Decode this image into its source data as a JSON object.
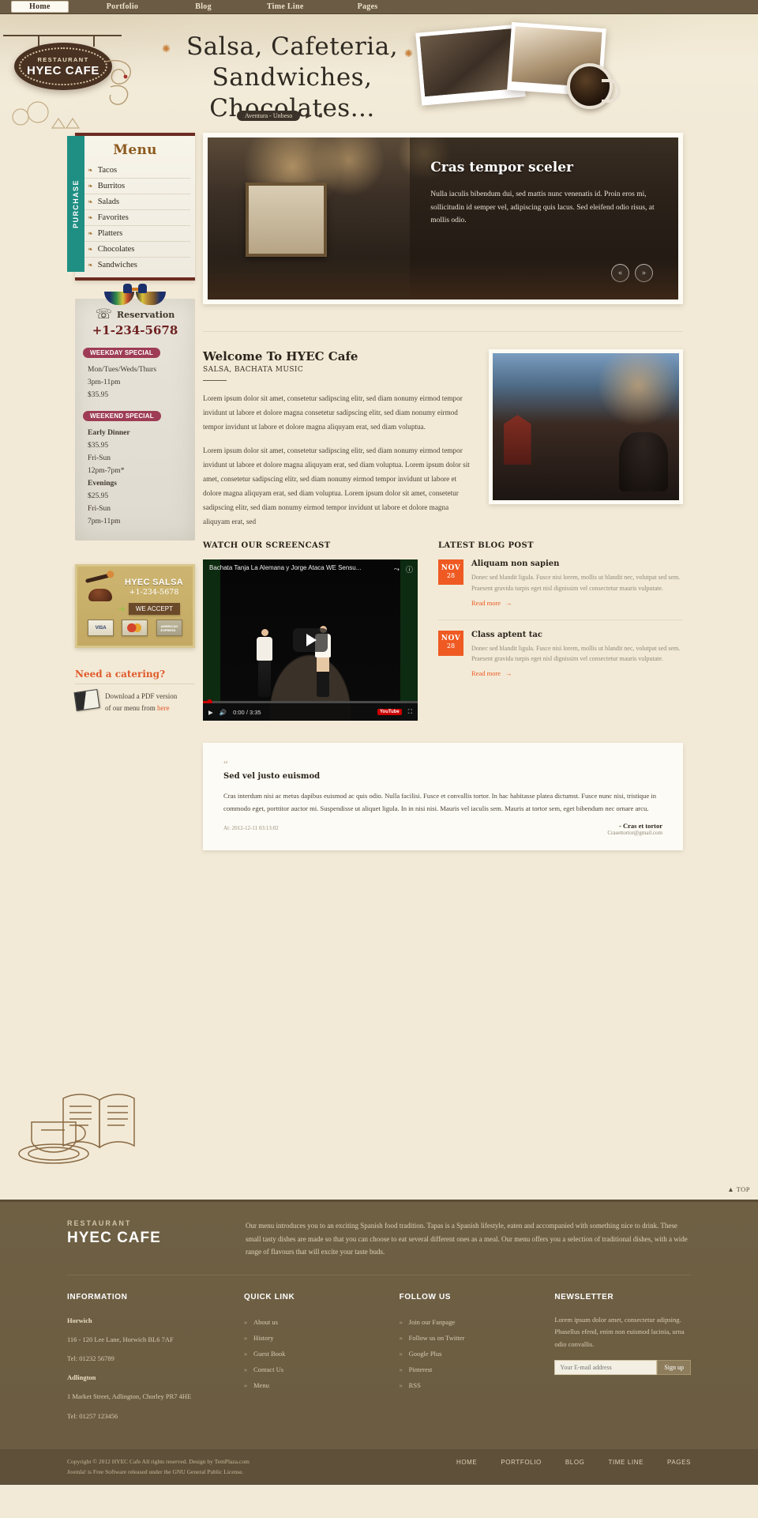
{
  "topnav": {
    "items": [
      {
        "label": "Home",
        "active": true
      },
      {
        "label": "Portfolio",
        "active": false
      },
      {
        "label": "Blog",
        "active": false
      },
      {
        "label": "Time Line",
        "active": false
      },
      {
        "label": "Pages",
        "active": false
      }
    ]
  },
  "header": {
    "logo_restaurant": "RESTAURANT",
    "logo_name": "HYEC CAFE",
    "title_line1": "Salsa, Cafeteria,",
    "title_line2": "Sandwiches, Chocolates...",
    "player_label": "Aventura - Unbeso",
    "player_controls": "▶ ■"
  },
  "sidebar": {
    "purchase_tab": "PURCHASE",
    "menu_title": "Menu",
    "menu_items": [
      {
        "label": "Tacos"
      },
      {
        "label": "Burritos"
      },
      {
        "label": "Salads"
      },
      {
        "label": "Favorites"
      },
      {
        "label": "Platters"
      },
      {
        "label": "Chocolates"
      },
      {
        "label": "Sandwiches"
      }
    ],
    "reservation": {
      "label": "Reservation",
      "phone": "+1-234-5678"
    },
    "weekday_special": {
      "badge": "WEEKDAY SPECIAL",
      "lines": [
        "Mon/Tues/Weds/Thurs",
        "3pm-11pm",
        "$35.95"
      ]
    },
    "weekend_special": {
      "badge": "WEEKEND SPECIAL",
      "lines": [
        "Early Dinner",
        "$35.95",
        "Fri-Sun",
        "12pm-7pm*",
        "Evenings",
        "$25.95",
        "Fri-Sun",
        "7pm-11pm"
      ],
      "bold_indexes": [
        0,
        4
      ]
    },
    "salsa": {
      "title": "HYEC SALSA",
      "phone": "+1-234-5678",
      "accept_label": "WE ACCEPT",
      "cards": [
        "VISA",
        "MasterCard",
        "American Express"
      ]
    },
    "catering": {
      "heading": "Need a catering?",
      "text_line1": "Download a PDF version",
      "text_line2_pre": "of our menu from ",
      "link": "here"
    }
  },
  "slider": {
    "title": "Cras tempor sceler",
    "text": "Nulla iaculis bibendum dui, sed mattis nunc venenatis id. Proin eros mi, sollicitudin id semper vel, adipiscing quis lacus. Sed eleifend odio risus, at mollis odio.",
    "prev_icon": "«",
    "next_icon": "»"
  },
  "welcome": {
    "heading": "Welcome To HYEC Cafe",
    "subheading": "SALSA, BACHATA MUSIC",
    "paragraph1": "Lorem ipsum dolor sit amet, consetetur sadipscing elitr, sed diam nonumy eirmod tempor invidunt ut labore et dolore magna consetetur sadipscing elitr, sed diam nonumy eirmod tempor invidunt ut labore et dolore magna aliquyam erat, sed diam voluptua.",
    "paragraph2": "Lorem ipsum dolor sit amet, consetetur sadipscing elitr, sed diam nonumy eirmod tempor invidunt ut labore et dolore magna aliquyam erat, sed diam voluptua. Lorem ipsum dolor sit amet, consetetur sadipscing elitr, sed diam nonumy eirmod tempor invidunt ut labore et dolore magna aliquyam erat, sed diam voluptua. Lorem ipsum dolor sit amet, consetetur sadipscing elitr, sed diam nonumy eirmod tempor invidunt ut labore et dolore magna aliquyam erat, sed"
  },
  "screencast": {
    "heading": "WATCH OUR SCREENCAST",
    "video_title": "Bachata Tanja La Alemana y Jorge Ataca WE Sensu...",
    "current_time": "0:00",
    "duration": "3:35",
    "youtube_label": "YouTube"
  },
  "blog": {
    "heading": "LATEST BLOG POST",
    "posts": [
      {
        "month": "NOV",
        "day": "28",
        "title": "Aliquam non sapien",
        "text": "Donec sed blandit ligula. Fusce nisi lorem, mollis ut blandit nec, volutpat sed sem. Praesent gravida turpis eget nisl dignissim vel consectetur mauris vulputate.",
        "read_more": "Read more"
      },
      {
        "month": "NOV",
        "day": "28",
        "title": "Class aptent tac",
        "text": "Donec sed blandit ligula. Fusce nisi lorem, mollis ut blandit nec, volutpat sed sem. Praesent gravida turpis eget nisl dignissim vel consectetur mauris vulputate.",
        "read_more": "Read more"
      }
    ]
  },
  "testimonial": {
    "quote_mark": "“",
    "title": "Sed vel justo euismod",
    "text": "Cras interdum nisi ac metus dapibus euismod ac quis odio. Nulla facilisi. Fusce et convallis tortor. In hac habitasse platea dictumst. Fusce nunc nisi, tristique in commodo eget, porttitor auctor mi. Suspendisse ut aliquet ligula. In in nisi nisi. Mauris vel iaculis sem. Mauris at tortor sem, eget bibendum nec ornare arcu.",
    "date": "At: 2012-12-11 03:13:02",
    "author": "- Cras et tortor",
    "email": "Crasettortor@gmail.com"
  },
  "top_link": "▲ TOP",
  "footer": {
    "brand_restaurant": "RESTAURANT",
    "brand_name": "HYEC CAFE",
    "intro": "Our menu introduces you to an exciting Spanish food tradition. Tapas is a Spanish lifestyle, eaten and accompanied with something nice to drink. These small tasty dishes are made so that you can choose to eat several different ones as a meal. Our menu offers you a selection of traditional dishes, with a wide range of flavours that will excite your taste buds.",
    "information": {
      "heading": "INFORMATION",
      "lines": [
        {
          "text": "Horwich",
          "bold": true
        },
        {
          "text": "116 - 120 Lee Lane, Horwich BL6 7AF",
          "bold": false
        },
        {
          "text": "Tel: 01232 56789",
          "bold": false
        },
        {
          "text": "Adlington",
          "bold": true
        },
        {
          "text": "1 Market Street, Adlington, Chorley PR7 4HE",
          "bold": false
        },
        {
          "text": "Tel: 01257 123456",
          "bold": false
        }
      ]
    },
    "quick_link": {
      "heading": "QUICK LINK",
      "items": [
        "About us",
        "History",
        "Guest Book",
        "Contact Us",
        "Menu"
      ]
    },
    "follow_us": {
      "heading": "FOLLOW US",
      "items": [
        "Join our Fanpage",
        "Follow us on Twitter",
        "Google Plus",
        "Pinterest",
        "RSS"
      ]
    },
    "newsletter": {
      "heading": "NEWSLETTER",
      "text": "Lorem ipsum dolor amet, consectetur adipsing. Phasellus efend, enim non euismod lacinia, urna odio convallis.",
      "placeholder": "Your E-mail address",
      "button": "Sign up"
    },
    "copyright_line1": "Copyright © 2012 HYEC Cafe All rights reserved. Design by TemPlaza.com",
    "copyright_line2": "Joomla! is Free Software released under the GNU General Public License.",
    "bottom_nav": [
      "HOME",
      "PORTFOLIO",
      "BLOG",
      "TIME LINE",
      "PAGES"
    ]
  }
}
